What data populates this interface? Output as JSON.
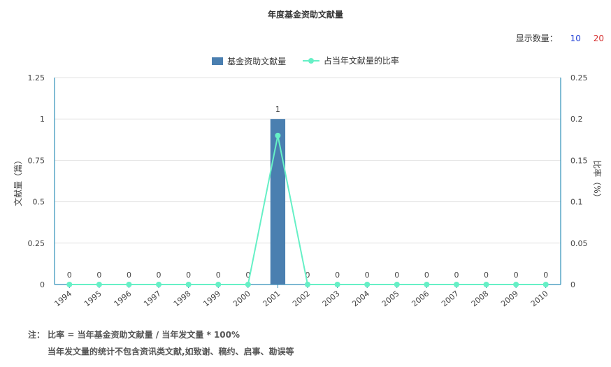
{
  "header": {
    "title": "年度基金资助文献量",
    "display_count_label": "显示数量：",
    "count_options": [
      "10",
      "20"
    ]
  },
  "colors": {
    "bar": "#4a7fb0",
    "line": "#66f0c6",
    "axis": "#2e8fb8",
    "grid": "#e3e3e3",
    "option_10": "#1f3fd6",
    "option_20": "#d62f2f"
  },
  "chart_data": {
    "type": "bar",
    "categories": [
      "1994",
      "1995",
      "1996",
      "1997",
      "1998",
      "1999",
      "2000",
      "2001",
      "2002",
      "2003",
      "2004",
      "2005",
      "2006",
      "2007",
      "2008",
      "2009",
      "2010"
    ],
    "series": [
      {
        "name": "基金资助文献量",
        "type": "bar",
        "axis": "left",
        "values": [
          0,
          0,
          0,
          0,
          0,
          0,
          0,
          1,
          0,
          0,
          0,
          0,
          0,
          0,
          0,
          0,
          0
        ]
      },
      {
        "name": "占当年文献量的比率",
        "type": "line",
        "axis": "right",
        "values": [
          0,
          0,
          0,
          0,
          0,
          0,
          0,
          0.18,
          0,
          0,
          0,
          0,
          0,
          0,
          0,
          0,
          0
        ]
      }
    ],
    "data_labels": [
      "0",
      "0",
      "0",
      "0",
      "0",
      "0",
      "0",
      "1",
      "0",
      "0",
      "0",
      "0",
      "0",
      "0",
      "0",
      "0",
      "0"
    ],
    "ylabel": "文献量（篇）",
    "y2label": "比率（%）",
    "ylim": [
      0,
      1.25
    ],
    "y2lim": [
      0,
      0.25
    ],
    "yticks": [
      "0",
      "0.25",
      "0.5",
      "0.75",
      "1",
      "1.25"
    ],
    "y2ticks": [
      "0",
      "0.05",
      "0.1",
      "0.15",
      "0.2",
      "0.25"
    ],
    "grid": true,
    "legend_position": "top-center"
  },
  "notes": {
    "line1": "注： 比率 = 当年基金资助文献量 / 当年发文量 * 100%",
    "line2": "当年发文量的统计不包含资讯类文献,如致谢、稿约、启事、勘误等"
  }
}
